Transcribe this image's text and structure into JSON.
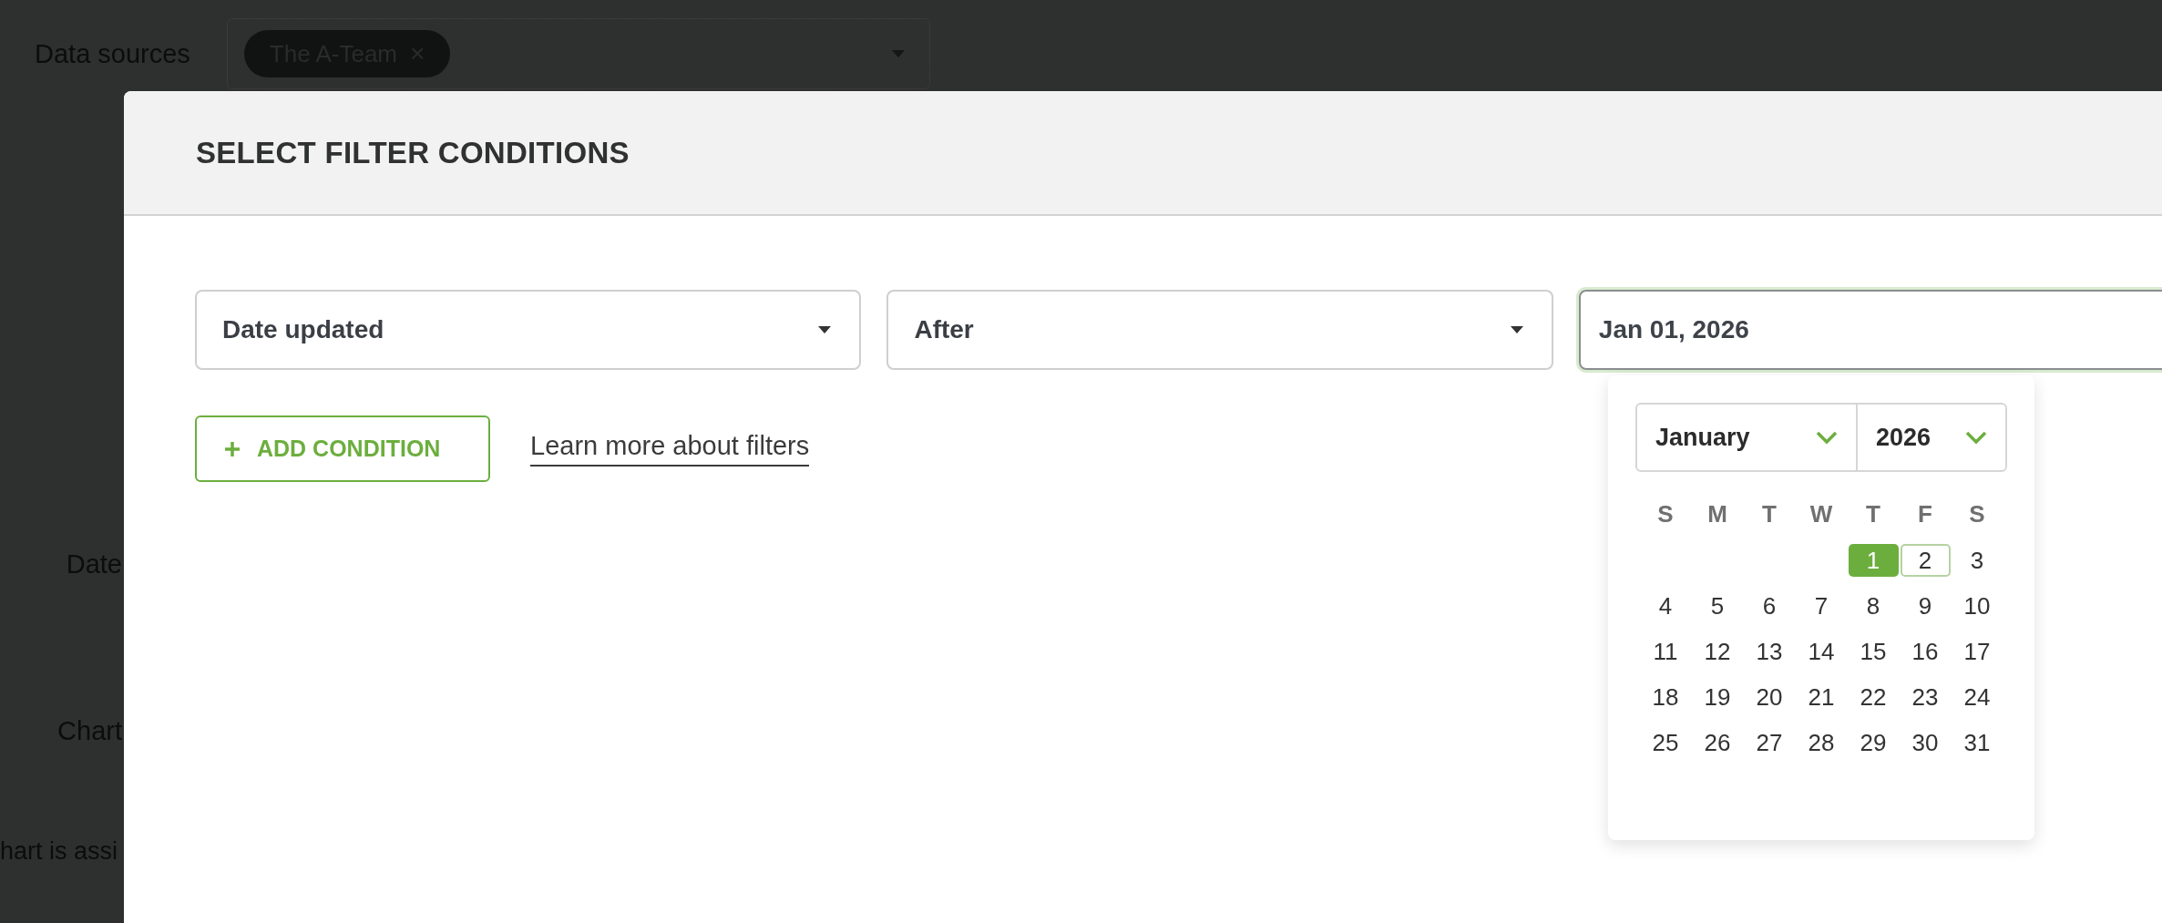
{
  "background": {
    "data_sources_label": "Data sources",
    "chips": [
      {
        "label": "The A-Team",
        "remove": "×"
      }
    ],
    "labels": [
      "Date",
      "Chart"
    ],
    "note": "hart is assi"
  },
  "modal": {
    "title": "SELECT FILTER CONDITIONS",
    "condition": {
      "field": "Date updated",
      "operator": "After",
      "value": "Jan 01, 2026"
    },
    "add_button": "ADD CONDITION",
    "link": "Learn more about filters",
    "datepicker": {
      "month": "January",
      "year": "2026",
      "weekdays": [
        "S",
        "M",
        "T",
        "W",
        "T",
        "F",
        "S"
      ],
      "weeks": [
        [
          {
            "label": "1",
            "selected": true,
            "focused": false
          },
          {
            "label": "2",
            "selected": false,
            "focused": true
          },
          {
            "label": "3",
            "selected": false,
            "focused": false
          }
        ],
        [
          {
            "label": "4",
            "selected": false,
            "focused": false
          },
          {
            "label": "5",
            "selected": false,
            "focused": false
          },
          {
            "label": "6",
            "selected": false,
            "focused": false
          },
          {
            "label": "7",
            "selected": false,
            "focused": false
          },
          {
            "label": "8",
            "selected": false,
            "focused": false
          },
          {
            "label": "9",
            "selected": false,
            "focused": false
          },
          {
            "label": "10",
            "selected": false,
            "focused": false
          }
        ],
        [
          {
            "label": "11",
            "selected": false,
            "focused": false
          },
          {
            "label": "12",
            "selected": false,
            "focused": false
          },
          {
            "label": "13",
            "selected": false,
            "focused": false
          },
          {
            "label": "14",
            "selected": false,
            "focused": false
          },
          {
            "label": "15",
            "selected": false,
            "focused": false
          },
          {
            "label": "16",
            "selected": false,
            "focused": false
          },
          {
            "label": "17",
            "selected": false,
            "focused": false
          }
        ],
        [
          {
            "label": "18",
            "selected": false,
            "focused": false
          },
          {
            "label": "19",
            "selected": false,
            "focused": false
          },
          {
            "label": "20",
            "selected": false,
            "focused": false
          },
          {
            "label": "21",
            "selected": false,
            "focused": false
          },
          {
            "label": "22",
            "selected": false,
            "focused": false
          },
          {
            "label": "23",
            "selected": false,
            "focused": false
          },
          {
            "label": "24",
            "selected": false,
            "focused": false
          }
        ],
        [
          {
            "label": "25",
            "selected": false,
            "focused": false
          },
          {
            "label": "26",
            "selected": false,
            "focused": false
          },
          {
            "label": "27",
            "selected": false,
            "focused": false
          },
          {
            "label": "28",
            "selected": false,
            "focused": false
          },
          {
            "label": "29",
            "selected": false,
            "focused": false
          },
          {
            "label": "30",
            "selected": false,
            "focused": false
          },
          {
            "label": "31",
            "selected": false,
            "focused": false
          }
        ]
      ]
    }
  }
}
